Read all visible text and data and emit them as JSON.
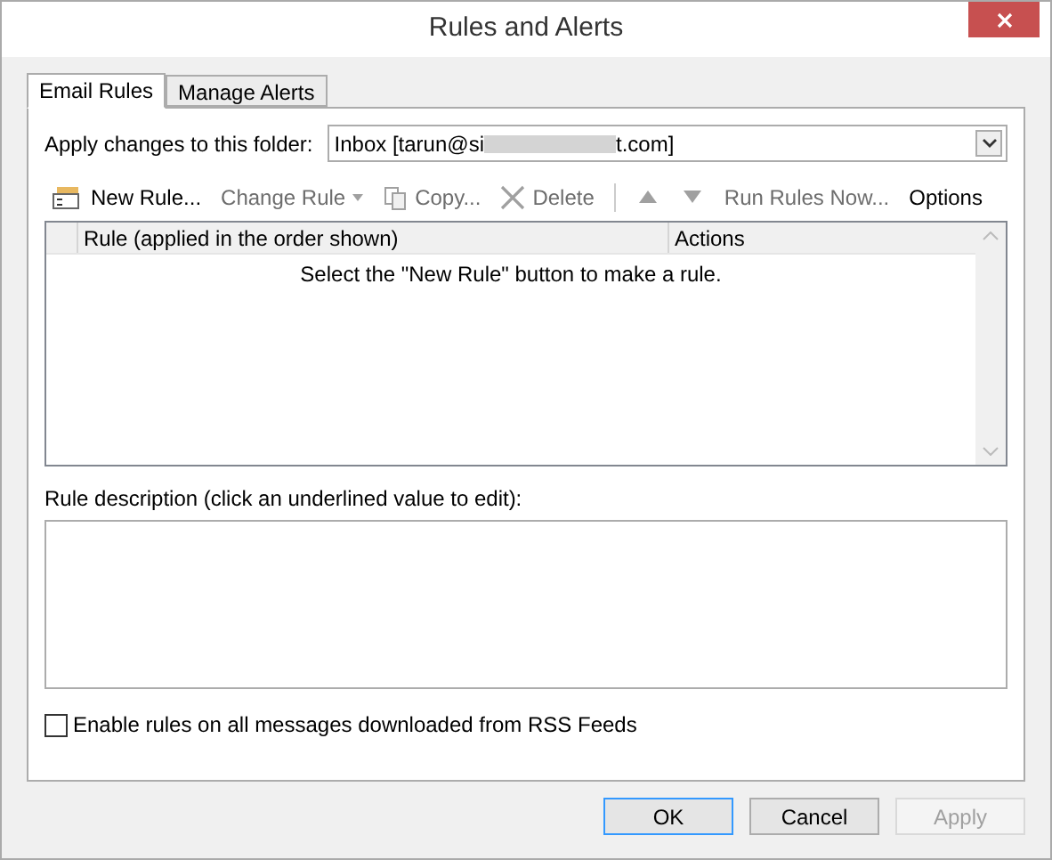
{
  "window": {
    "title": "Rules and Alerts"
  },
  "tabs": [
    {
      "label": "Email Rules",
      "selected": true
    },
    {
      "label": "Manage Alerts",
      "selected": false
    }
  ],
  "folder": {
    "label": "Apply changes to this folder:",
    "value_start": "Inbox [tarun@si",
    "value_end": "t.com]"
  },
  "toolbar": [
    {
      "kind": "new",
      "label": "New Rule...",
      "disabled": false
    },
    {
      "kind": "change",
      "label": "Change Rule",
      "disabled": true
    },
    {
      "kind": "copy",
      "label": "Copy...",
      "disabled": true
    },
    {
      "kind": "delete",
      "label": "Delete",
      "disabled": true
    },
    {
      "kind": "up",
      "disabled": true
    },
    {
      "kind": "down",
      "disabled": true
    },
    {
      "kind": "run",
      "label": "Run Rules Now...",
      "disabled": true
    },
    {
      "kind": "options",
      "label": "Options",
      "disabled": false
    }
  ],
  "table": {
    "columns": [
      "Rule (applied in the order shown)",
      "Actions"
    ],
    "empty_message": "Select the \"New Rule\" button to make a rule."
  },
  "description": {
    "label": "Rule description (click an underlined value to edit):"
  },
  "rss": {
    "label": "Enable rules on all messages downloaded from RSS Feeds",
    "checked": false
  },
  "buttons": [
    {
      "label": "OK",
      "default": true,
      "disabled": false
    },
    {
      "label": "Cancel",
      "default": false,
      "disabled": false
    },
    {
      "label": "Apply",
      "default": false,
      "disabled": true
    }
  ]
}
